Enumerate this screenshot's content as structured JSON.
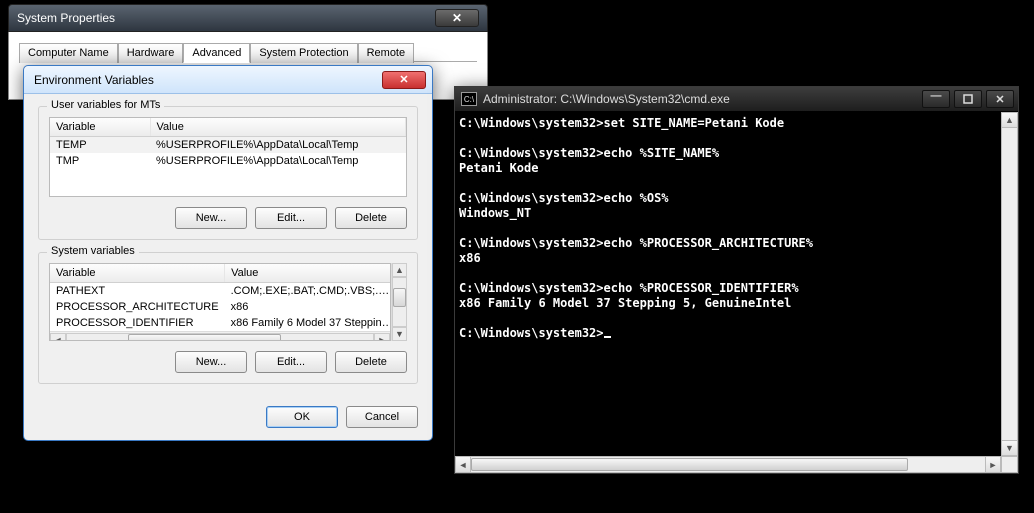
{
  "sysprops": {
    "title": "System Properties",
    "tabs": [
      "Computer Name",
      "Hardware",
      "Advanced",
      "System Protection",
      "Remote"
    ],
    "active_tab_index": 2
  },
  "envdlg": {
    "title": "Environment Variables",
    "user_section_label": "User variables for MTs",
    "system_section_label": "System variables",
    "columns": {
      "variable": "Variable",
      "value": "Value"
    },
    "user_vars": [
      {
        "name": "TEMP",
        "value": "%USERPROFILE%\\AppData\\Local\\Temp"
      },
      {
        "name": "TMP",
        "value": "%USERPROFILE%\\AppData\\Local\\Temp"
      }
    ],
    "system_vars": [
      {
        "name": "PATHEXT",
        "value": ".COM;.EXE;.BAT;.CMD;.VBS;.…"
      },
      {
        "name": "PROCESSOR_ARCHITECTURE",
        "value": "x86"
      },
      {
        "name": "PROCESSOR_IDENTIFIER",
        "value": "x86 Family 6 Model 37 Steppin…"
      }
    ],
    "buttons": {
      "new": "New...",
      "edit": "Edit...",
      "delete": "Delete",
      "ok": "OK",
      "cancel": "Cancel"
    }
  },
  "cmd": {
    "title": "Administrator: C:\\Windows\\System32\\cmd.exe",
    "icon_text": "C:\\",
    "lines": [
      "C:\\Windows\\system32>set SITE_NAME=Petani Kode",
      "",
      "C:\\Windows\\system32>echo %SITE_NAME%",
      "Petani Kode",
      "",
      "C:\\Windows\\system32>echo %OS%",
      "Windows_NT",
      "",
      "C:\\Windows\\system32>echo %PROCESSOR_ARCHITECTURE%",
      "x86",
      "",
      "C:\\Windows\\system32>echo %PROCESSOR_IDENTIFIER%",
      "x86 Family 6 Model 37 Stepping 5, GenuineIntel",
      "",
      "C:\\Windows\\system32>"
    ]
  }
}
